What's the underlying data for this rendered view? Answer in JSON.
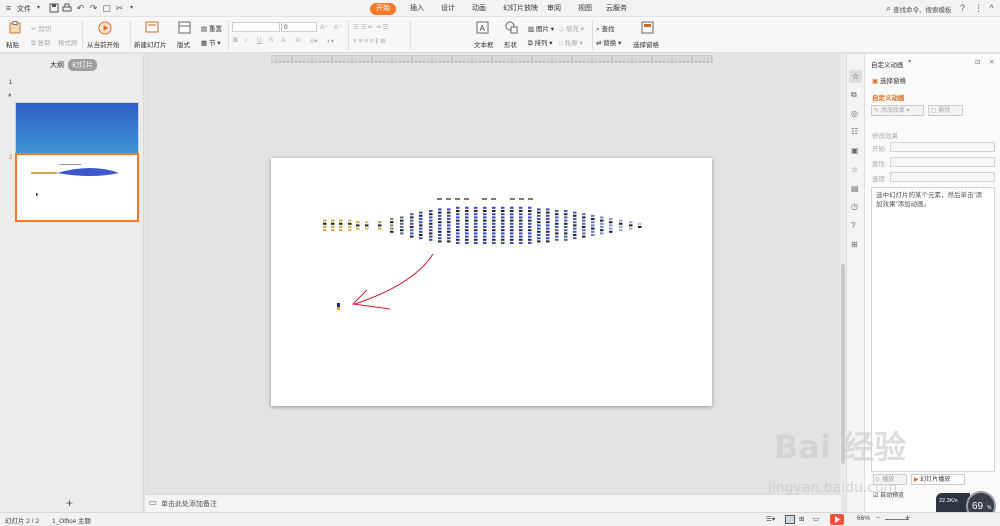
{
  "titlebar": {
    "file_menu": "文件",
    "tabs": [
      "开始",
      "插入",
      "设计",
      "动画",
      "幻灯片放映",
      "审阅",
      "视图",
      "云服务"
    ],
    "active_tab": "开始",
    "search_placeholder": "查找命令、搜索模板"
  },
  "ribbon": {
    "paste": "粘贴",
    "cut": "剪切",
    "copy": "复制",
    "format_painter": "格式刷",
    "from_current": "从当前开始",
    "new_slide": "新建幻灯片",
    "layout": "版式",
    "reset": "重置",
    "section": "节",
    "font_size": "0",
    "textbox": "文本框",
    "shape": "形状",
    "picture": "图片",
    "arrange": "排列",
    "fill": "填充",
    "outline": "轮廓",
    "find": "查找",
    "replace": "替换",
    "select_pane": "选择窗格"
  },
  "leftpane": {
    "tab_outline": "大纲",
    "tab_slides": "幻灯片",
    "slide_numbers": [
      "1",
      "2"
    ]
  },
  "notes": {
    "placeholder": "单击此处添加备注"
  },
  "taskpane": {
    "title": "自定义动画",
    "select_pane": "选择窗格",
    "section_title": "自定义动画",
    "add_effect": "添加效果",
    "delete": "删除",
    "modify_effect": "修改效果",
    "start_label": "开始:",
    "property_label": "属性:",
    "speed_label": "速度:",
    "hint": "选中幻灯片的某个元素，然后单击“添加效果”添加动画。",
    "play": "播放",
    "slideshow": "幻灯片播放",
    "auto_preview": "自动预览"
  },
  "status": {
    "slide_info": "幻灯片 2 / 2",
    "theme": "1_Office 主题",
    "zoom": "66%",
    "net_speed": "22.3K/s",
    "cpu": "69",
    "cpu_unit": "%"
  },
  "watermark": {
    "brand": "Bai 经验",
    "url": "jingyan.baidu.com"
  },
  "colors": {
    "accent": "#f47a2a",
    "taskpane_title": "#e0681e"
  }
}
